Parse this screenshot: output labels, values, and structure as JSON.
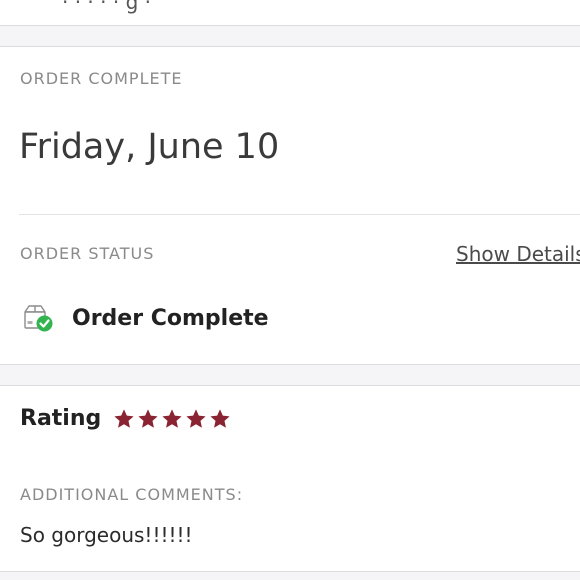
{
  "top": {
    "partial_text": "· · · · · g ·"
  },
  "order": {
    "section_label": "ORDER COMPLETE",
    "date": "Friday, June 10",
    "status_label": "ORDER STATUS",
    "show_details_label": "Show Details",
    "status_text": "Order Complete",
    "status_icon": "package-check-icon",
    "status_color": "#34b451"
  },
  "rating": {
    "label": "Rating",
    "stars": 5,
    "max_stars": 5,
    "star_color": "#8a2432",
    "comments_label": "ADDITIONAL COMMENTS:",
    "comment": "So gorgeous!!!!!!"
  }
}
